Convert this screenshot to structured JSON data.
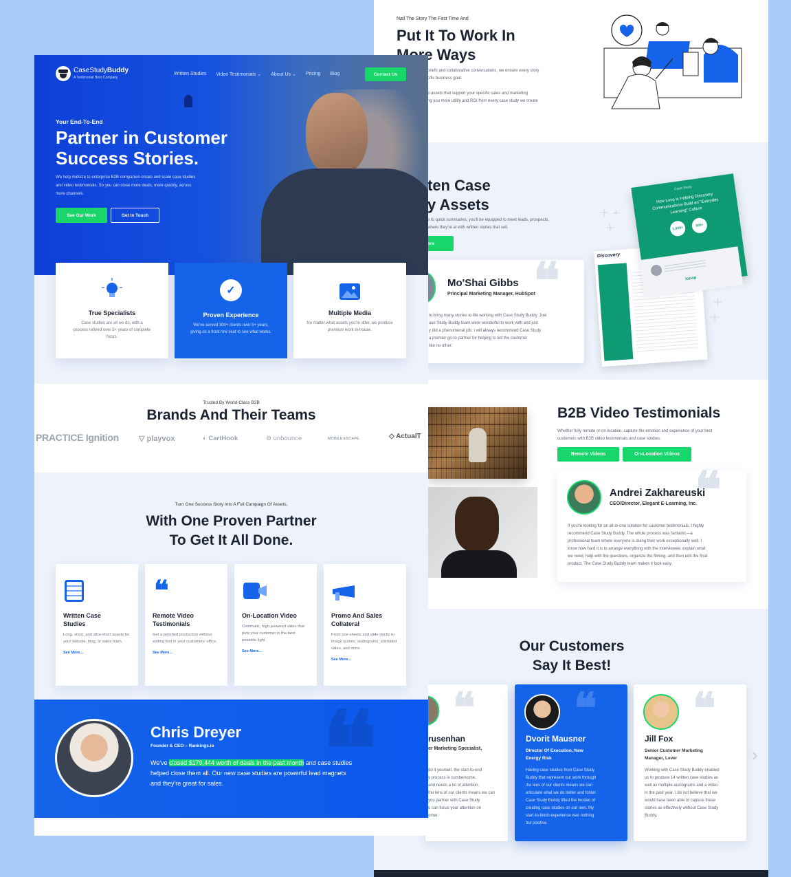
{
  "back_page": {
    "s1": {
      "kicker": "Nail The Story The First Time And",
      "title1": "Put It To Work In",
      "title2": "More Ways",
      "p1a": "briefs and collaborative conversations, we ensure every story",
      "p1b": "cific business goal.",
      "p2a": "e assets that support your specific sales and marketing",
      "p2b": "ng you more utility and ROI from every case study we create"
    },
    "s2": {
      "title1": "ten Case",
      "title2": "y Assets",
      "p1": "e to quick summaries, you'll be equipped to meet leads, prospects,",
      "p2": "where they're at with written stories that sell.",
      "btn": "ore",
      "quote_name": "Mo'Shai Gibbs",
      "quote_role": "Principal Marketing Manager, HubSpot",
      "quote_lines": [
        "to bring many stories to life working with Case Study Buddy. Joel",
        "ase Study Buddy team were wonderful to work with and just",
        "y did a phenomenal job. I will always recommend Case Study",
        "a premier go-to partner for helping to tell the customer",
        "like no other."
      ],
      "doc_header": "Case Study",
      "doc_title": "How Loop is Helping Discovery Communications Build an \"Everyday Learning\" Culture",
      "doc_stat1": "1,000+",
      "doc_stat2": "300+",
      "doc_logo": "Discovery",
      "doc_brand": "looop"
    },
    "s3": {
      "title": "B2B Video Testimonials",
      "p1": "Whether fully remote or on-location, capture the emotion and experience of your best",
      "p2": "customers with B2B video testimonials and case studies.",
      "btn1": "Remote Videos",
      "btn2": "On-Location Videos",
      "quote_name": "Andrei Zakhareuski",
      "quote_role": "CEO/Director, Elegant E-Learning, Inc.",
      "quote_lines": [
        "If you're looking for an all-in-one solution for customer testimonials, I highly",
        "recommend Case Study Buddy. The whole process was fantastic—a",
        "professional team where everyone is doing their work exceptionally well. I",
        "know how hard it is to arrange everything with the interviewee; explain what",
        "we need, help with the questions, organize the filming, and then edit the final",
        "product. The Case Study Buddy team makes it look easy."
      ]
    },
    "s4": {
      "title1": "Our Customers",
      "title2": "Say It Best!",
      "c1": {
        "name": "rusenhan",
        "role": "er Marketing Specialist,",
        "lines": [
          "do it yourself, the start-to-end",
          "y process is cumbersome,",
          "and needs a lot of attention.",
          "the lens of our clients means we can",
          "you partner with Case Study",
          "u can focus your attention on",
          "omer."
        ]
      },
      "c2": {
        "name": "Dvorit Mausner",
        "role1": "Director Of Execution, New",
        "role2": "Energy Risk",
        "lines": [
          "Having case studies from Case Study",
          "Buddy that represent our work through",
          "the lens of our clients means we can",
          "articulate what we do better and foster.",
          "Case Study Buddy lifted the burden of",
          "creating case studies on our own. My",
          "start-to-finish experience was nothing",
          "but positive."
        ]
      },
      "c3": {
        "name": "Jill Fox",
        "role1": "Senior Customer Marketing",
        "role2": "Manager, Lever",
        "lines": [
          "Working with Case Study Buddy enabled",
          "us to produce 14 written case studies as",
          "well as multiple audiograms and a video",
          "in the past year. I do not believe that we",
          "would have been able to capture these",
          "stories as effectively without Case Study",
          "Buddy."
        ]
      },
      "next": "›"
    }
  },
  "front_page": {
    "brand": {
      "name_light": "CaseStudy",
      "name_bold": "Buddy",
      "tagline": "A Testimonial Hero Company"
    },
    "nav": [
      "Written Studies",
      "Video Testimonials ⌄",
      "About Us ⌄",
      "Pricing",
      "Blog"
    ],
    "nav_cta": "Contact Us",
    "hero": {
      "kicker": "Your End-To-End",
      "title1": "Partner in Customer",
      "title2": "Success Stories.",
      "sub1": "We help midsize to enterprise B2B companies create and scale case studies",
      "sub2": "and video testimonials. So you can close more deals, more quickly, across",
      "sub3": "more channels.",
      "btn1": "See Our Work",
      "btn2": "Get In Touch"
    },
    "features": [
      {
        "title": "True Specialists",
        "text": "Case studies are all we do, with a process refined over 5+ years of complete focus."
      },
      {
        "title": "Proven Experience",
        "text": "We've served 300+ clients over 5+ years, giving us a front row seat to see what works."
      },
      {
        "title": "Multiple Media",
        "text": "No matter what assets you're after, we produce premium work in-house."
      }
    ],
    "brands": {
      "kicker": "Trusted By World-Class B2B",
      "title": "Brands And Their Teams",
      "logos": [
        "PRACTICE Ignition",
        "playvox",
        "CartHook",
        "unbounce",
        "MOBILE ESCAPE",
        "ActualT"
      ]
    },
    "services": {
      "kicker": "Turn One Success Story Into A Full Campaign Of Assets,",
      "title1": "With One Proven Partner",
      "title2": "To Get It All Done.",
      "items": [
        {
          "t1": "Written Case",
          "t2": "Studies",
          "text": "Long, short, and ultra-short assets for your website, blog, or sales team.",
          "more": "See More..."
        },
        {
          "t1": "Remote Video",
          "t2": "Testimonials",
          "text": "Get a polished production without setting foot in your customers' office.",
          "more": "See More..."
        },
        {
          "t1": "On-Location Video",
          "t2": "",
          "text": "Cinematic, high-powered video that puts your customer in the best possible light.",
          "more": "See More..."
        },
        {
          "t1": "Promo And Sales",
          "t2": "Collateral",
          "text": "From one-sheets and slide decks to image quotes, audiograms, animated video, and more.",
          "more": "See More..."
        }
      ]
    },
    "testimonial": {
      "name": "Chris Dreyer",
      "role": "Founder & CEO – Rankings.io",
      "pre": "We've ",
      "highlight": "closed $179,444 worth of deals in the past month",
      "post": " and case studies",
      "line2": "helped close them all. Our new case studies are powerful lead magnets",
      "line3": "and they're great for sales."
    }
  },
  "colors": {
    "blue": "#1463e8",
    "deep_blue": "#0d3fd8",
    "green": "#19d66a",
    "page_bg": "#a7cbf9"
  }
}
